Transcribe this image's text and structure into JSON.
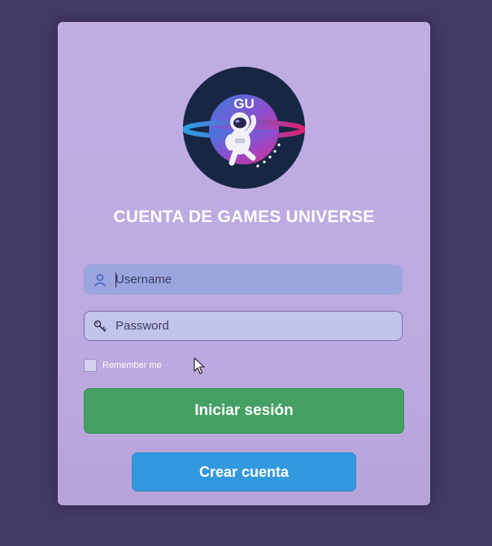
{
  "logo": {
    "text": "GU",
    "icon": "astronaut-planet-logo"
  },
  "title": "CUENTA DE GAMES UNIVERSE",
  "username": {
    "value": "",
    "placeholder": "Username",
    "icon": "user-icon"
  },
  "password": {
    "value": "",
    "placeholder": "Password",
    "icon": "key-icon"
  },
  "remember": {
    "label": "Remember me",
    "checked": false
  },
  "buttons": {
    "login": "Iniciar sesión",
    "create": "Crear cuenta"
  },
  "colors": {
    "background": "#433a66",
    "card": "#c0aee3",
    "login_button": "#43a062",
    "create_button": "#3399de",
    "logo_background": "#172743"
  }
}
